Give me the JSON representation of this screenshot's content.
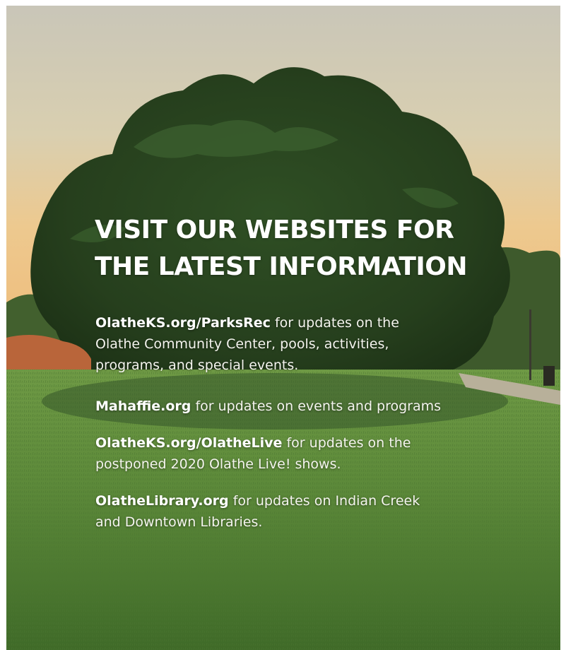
{
  "headline": {
    "line1": "VISIT OUR WEBSITES FOR",
    "line2": "THE LATEST INFORMATION"
  },
  "entries": [
    {
      "link": "OlatheKS.org/ParksRec",
      "desc_line1": " for updates on the",
      "desc_line2": "Olathe Community Center, pools, activities,",
      "desc_line3": "programs, and special events."
    },
    {
      "link": "Mahaffie.org",
      "desc_line1": " for updates on events and programs"
    },
    {
      "link": "OlatheKS.org/OlatheLive",
      "desc_line1": " for updates on the",
      "desc_line2": "postponed 2020 Olathe Live! shows."
    },
    {
      "link": "OlatheLibrary.org",
      "desc_line1": " for updates on Indian Creek",
      "desc_line2": "and Downtown Libraries."
    }
  ]
}
